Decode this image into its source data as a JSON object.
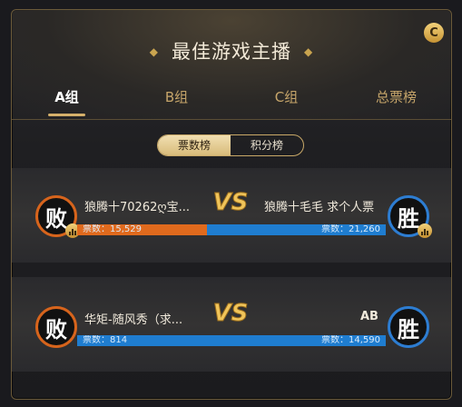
{
  "header": {
    "title": "最佳游戏主播",
    "close_icon": "C"
  },
  "tabs": [
    {
      "label": "A组",
      "active": true
    },
    {
      "label": "B组",
      "active": false
    },
    {
      "label": "C组",
      "active": false
    },
    {
      "label": "总票榜",
      "active": false
    }
  ],
  "subtabs": [
    {
      "label": "票数榜",
      "active": true
    },
    {
      "label": "积分榜",
      "active": false
    }
  ],
  "matches": [
    {
      "left": {
        "name": "狼腾十70262ღ宝...",
        "result": "败",
        "votes_label": "票数：15,529",
        "votes": 15529
      },
      "right": {
        "name": "狼腾十毛毛 求个人票",
        "result": "胜",
        "votes_label": "票数：21,260",
        "votes": 21260
      },
      "vs_text": "VS",
      "left_share": 0.42
    },
    {
      "left": {
        "name": "华矩-随风秀（求...",
        "result": "败",
        "votes_label": "票数：814",
        "votes": 814
      },
      "right": {
        "name": "AB",
        "result": "胜",
        "votes_label": "票数：14,590",
        "votes": 14590
      },
      "vs_text": "VS",
      "left_share": 0.0
    }
  ],
  "colors": {
    "accent": "#d5b06a",
    "lose": "#d7641c",
    "win": "#2d7dd2"
  }
}
